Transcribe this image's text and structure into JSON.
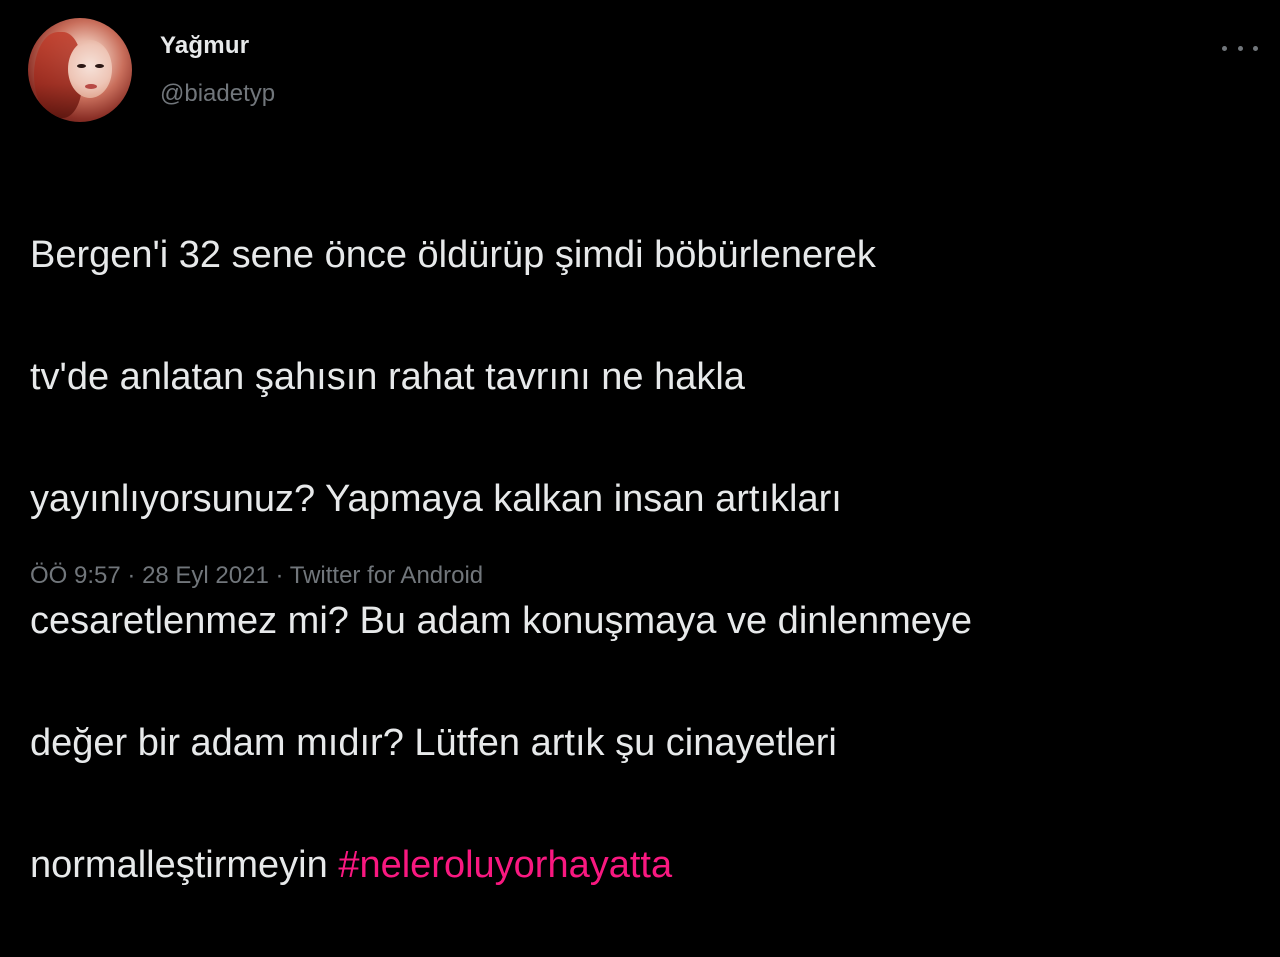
{
  "user": {
    "display_name": "Yağmur",
    "handle": "@biadetyp",
    "avatar_icon": "profile-photo"
  },
  "more_icon": "more-horizontal-icon",
  "tweet": {
    "lines": [
      "Bergen'i 32 sene önce öldürüp şimdi böbürlenerek",
      "tv'de anlatan şahısın rahat tavrını ne hakla",
      "yayınlıyorsunuz? Yapmaya kalkan insan artıkları",
      "cesaretlenmez mi? Bu adam konuşmaya ve dinlenmeye",
      "değer bir adam mıdır? Lütfen artık şu cinayetleri"
    ],
    "last_line_text": "normalleştirmeyin ",
    "hashtag": "#neleroluyorhayatta"
  },
  "meta": {
    "time": "ÖÖ 9:57",
    "separator": "·",
    "date": "28 Eyl 2021",
    "source": "Twitter for Android"
  },
  "colors": {
    "background": "#000000",
    "text": "#e7e9ea",
    "muted": "#71767b",
    "hashtag": "#f91880"
  }
}
